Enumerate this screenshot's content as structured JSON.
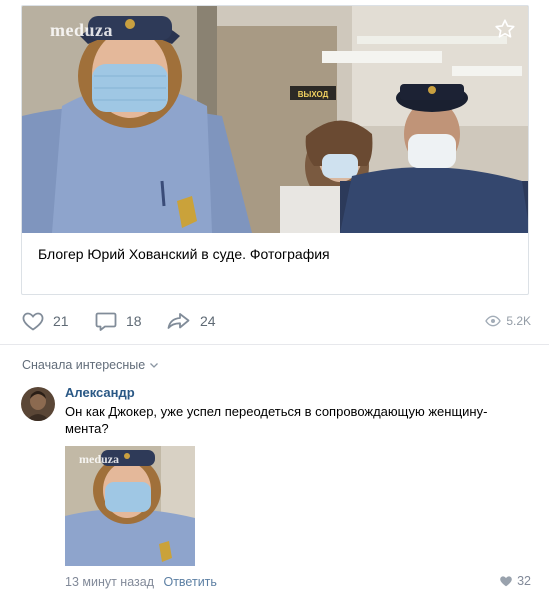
{
  "post": {
    "watermark": "meduza",
    "sign": "ВЫХОД",
    "caption": "Блогер Юрий Хованский в суде. Фотография"
  },
  "actions": {
    "likes": "21",
    "comments": "18",
    "shares": "24",
    "views": "5.2K"
  },
  "sort_label": "Сначала интересные",
  "comment": {
    "author": "Александр",
    "text": "Он как Джокер, уже успел переодеться в сопровождающую женщину-мента?",
    "watermark": "meduza",
    "time": "13 минут назад",
    "reply_label": "Ответить",
    "likes": "32"
  },
  "colors": {
    "link": "#2a5885",
    "muted": "#828a99",
    "card_border": "#dce1e6"
  }
}
